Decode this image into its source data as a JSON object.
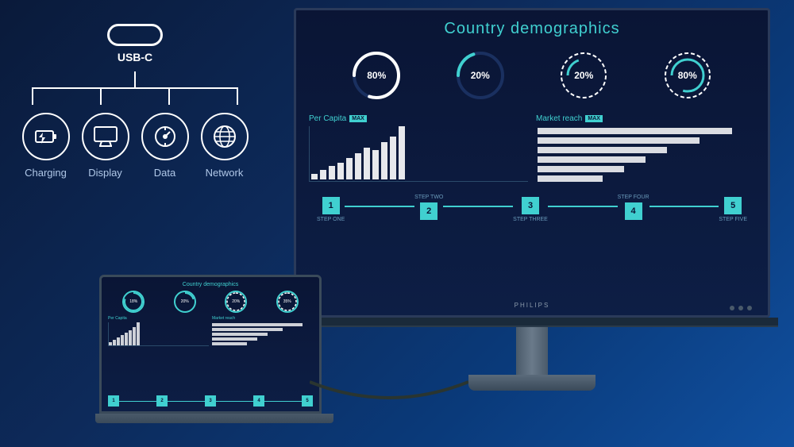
{
  "header": {
    "usbc_label": "USB-C"
  },
  "icons": [
    {
      "id": "charging",
      "label": "Charging",
      "type": "charging"
    },
    {
      "id": "display",
      "label": "Display",
      "type": "display"
    },
    {
      "id": "data",
      "label": "Data",
      "type": "data"
    },
    {
      "id": "network",
      "label": "Network",
      "type": "network"
    }
  ],
  "screen": {
    "title": "Country demographics",
    "circles": [
      {
        "value": "80%",
        "pct": 80
      },
      {
        "value": "20%",
        "pct": 20
      },
      {
        "value": "20%",
        "pct": 20
      },
      {
        "value": "80%",
        "pct": 80
      }
    ],
    "per_capita_title": "Per Capita",
    "market_reach_title": "Market reach",
    "max_label": "MAX",
    "bars": [
      10,
      18,
      25,
      30,
      38,
      45,
      55,
      50,
      60,
      65,
      70
    ],
    "hbars": [
      90,
      75,
      60,
      50,
      40,
      30
    ],
    "steps": [
      {
        "number": "1",
        "top": "",
        "bottom": "STEP ONE"
      },
      {
        "number": "2",
        "top": "STEP TWO",
        "bottom": ""
      },
      {
        "number": "3",
        "top": "",
        "bottom": "STEP THREE"
      },
      {
        "number": "4",
        "top": "STEP FOUR",
        "bottom": ""
      },
      {
        "number": "5",
        "top": "",
        "bottom": "STEP FIVE"
      }
    ]
  },
  "laptop": {
    "title": "Country demographics"
  },
  "monitor_brand": "PHILIPS"
}
